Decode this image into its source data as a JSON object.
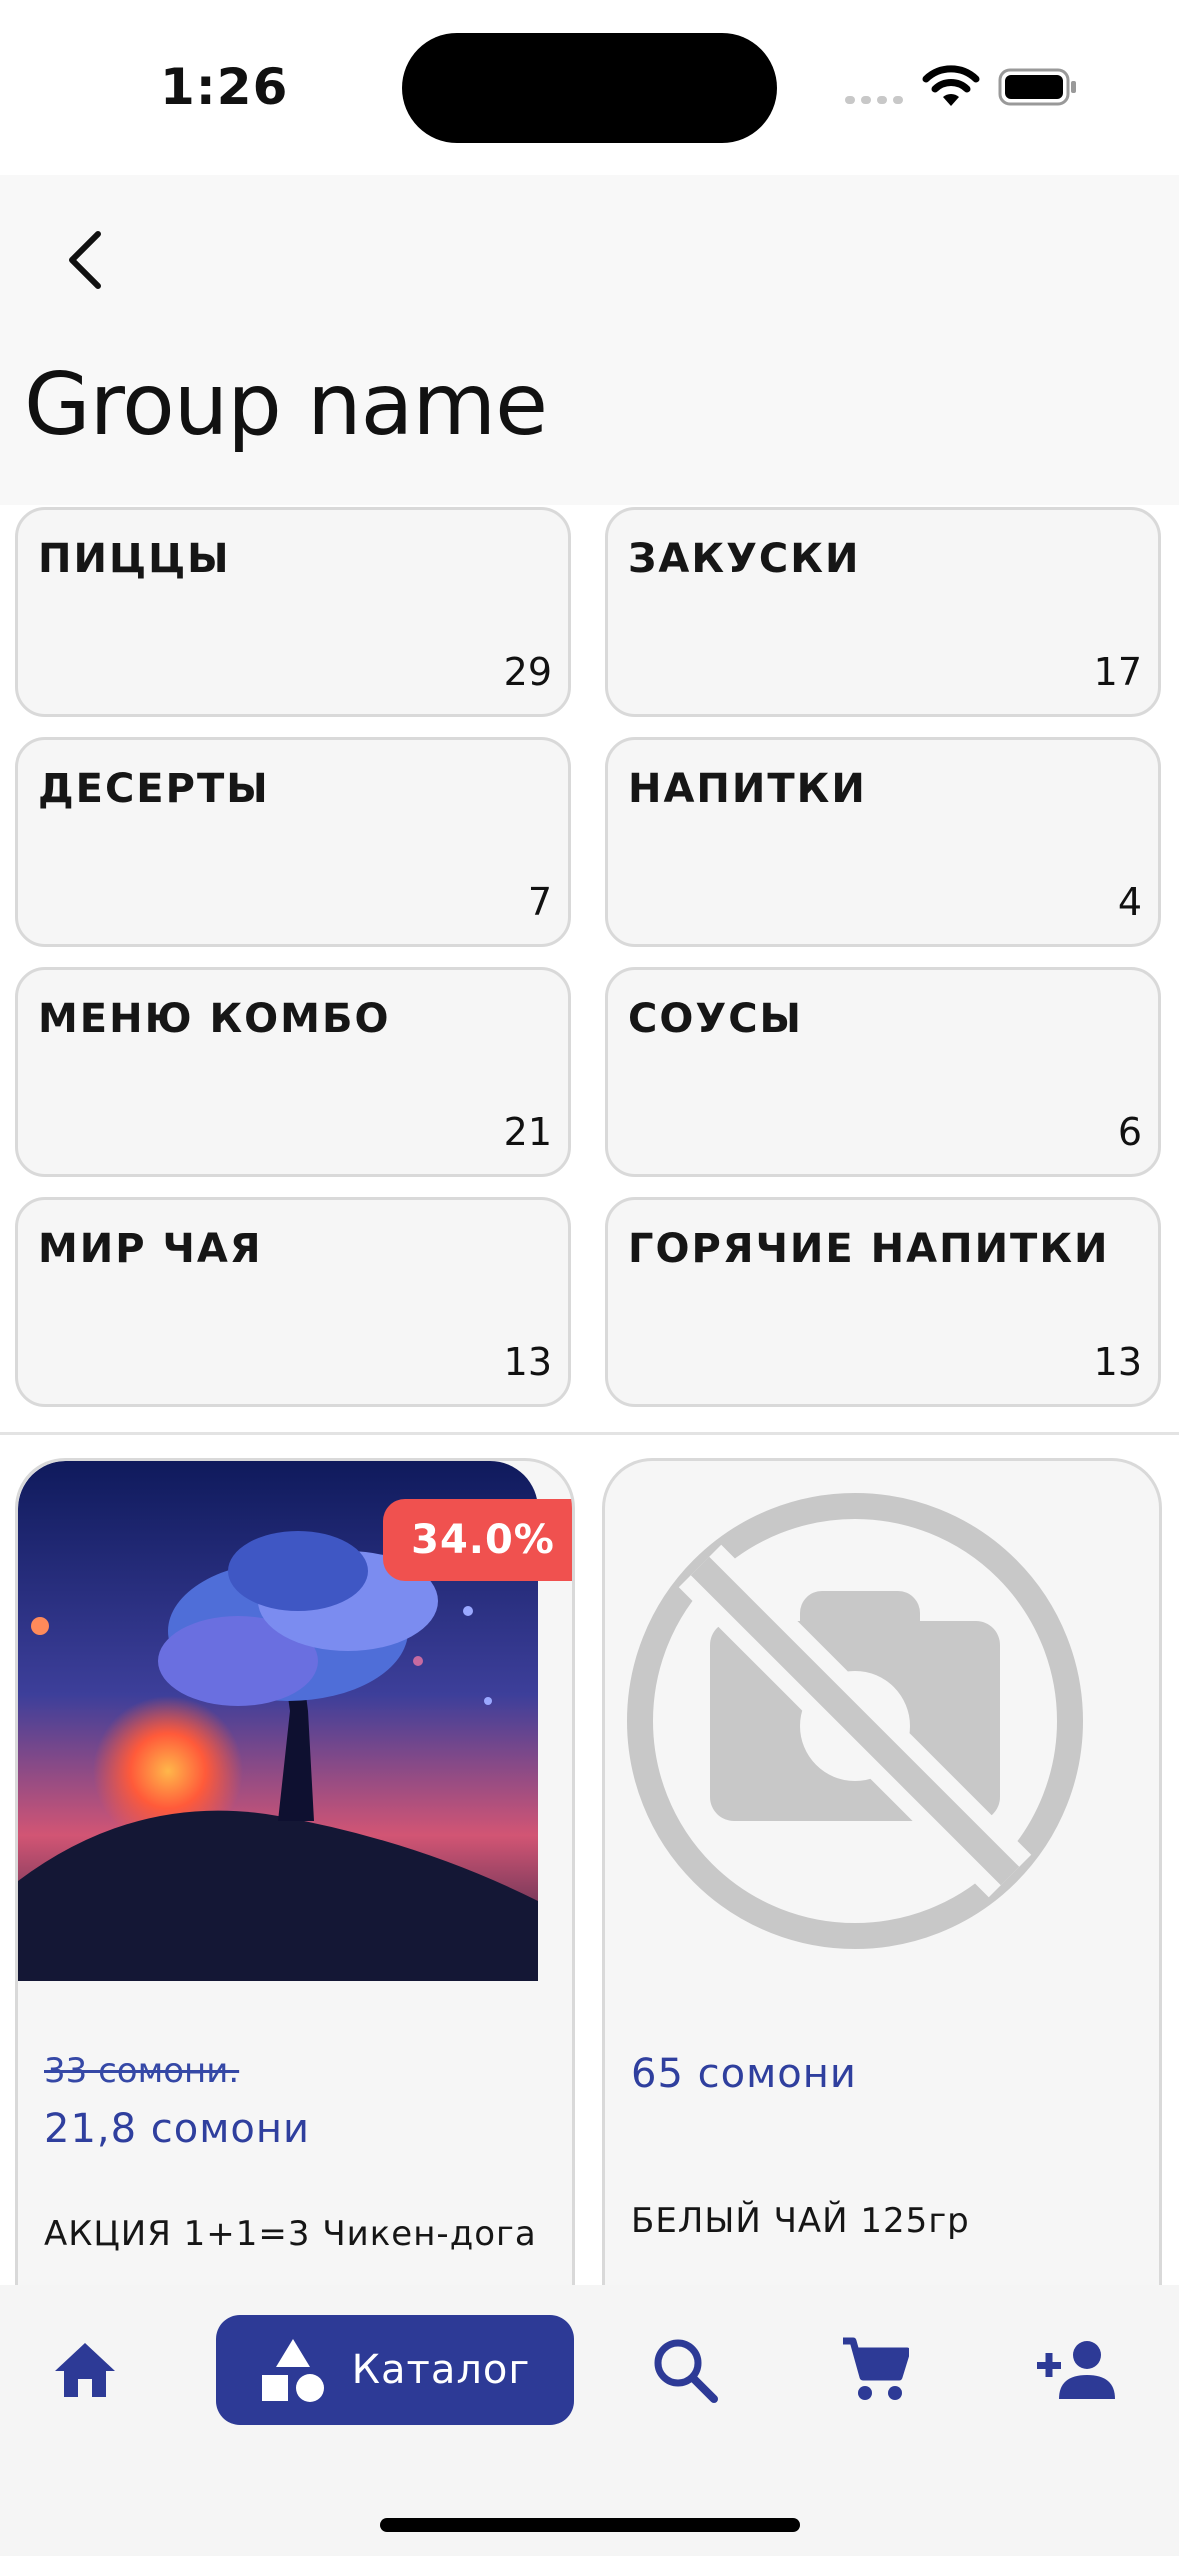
{
  "status_bar": {
    "time": "1:26"
  },
  "header": {
    "title": "Group name"
  },
  "categories": [
    {
      "name": "ПИЦЦЫ",
      "count": "29"
    },
    {
      "name": "ЗАКУСКИ",
      "count": "17"
    },
    {
      "name": "ДЕСЕРТЫ",
      "count": "7"
    },
    {
      "name": "НАПИТКИ",
      "count": "4"
    },
    {
      "name": "МЕНЮ КОМБО",
      "count": "21"
    },
    {
      "name": "СОУСЫ",
      "count": "6"
    },
    {
      "name": "МИР ЧАЯ",
      "count": "13"
    },
    {
      "name": "ГОРЯЧИЕ НАПИТКИ",
      "count": "13"
    }
  ],
  "products": [
    {
      "discount": "34.0%",
      "old_price": "33 сомони.",
      "price": "21,8 сомони",
      "name": "АКЦИЯ 1+1=3 Чикен-дога"
    },
    {
      "price": "65 сомони",
      "name": "БЕЛЫЙ ЧАЙ 125гр"
    }
  ],
  "bottom_nav": {
    "items": [
      {
        "icon": "home-icon"
      },
      {
        "icon": "catalog-icon",
        "label": "Каталог"
      },
      {
        "icon": "search-icon"
      },
      {
        "icon": "cart-icon"
      },
      {
        "icon": "add-person-icon"
      }
    ]
  },
  "colors": {
    "accent": "#2d3a96",
    "price": "#2f3f9e",
    "discount": "#f0514f",
    "card_bg": "#f6f6f6",
    "card_border": "#d9d9d9"
  }
}
